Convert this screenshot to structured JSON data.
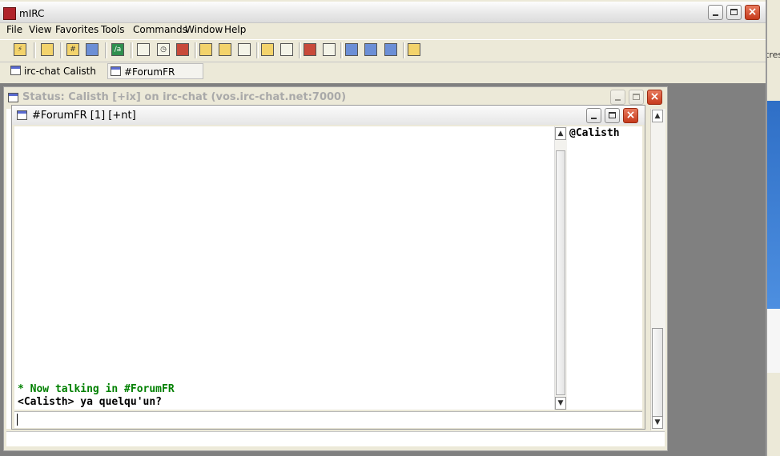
{
  "app": {
    "title": "mIRC",
    "accent_color": "#b0222a",
    "window_controls": {
      "minimize": "minimize-icon",
      "maximize": "maximize-icon",
      "close": "close-icon"
    }
  },
  "menu": [
    "File",
    "View",
    "Favorites",
    "Tools",
    "Commands",
    "Window",
    "Help"
  ],
  "toolbar": {
    "buttons": [
      {
        "icon": "connect-icon"
      },
      {
        "icon": "options-icon"
      },
      {
        "icon": "channel-list-icon"
      },
      {
        "icon": "favorites-icon"
      },
      {
        "icon": "script-editor-icon"
      },
      {
        "icon": "address-book-icon"
      },
      {
        "icon": "timer-icon"
      },
      {
        "icon": "colors-icon"
      },
      {
        "icon": "dcc-send-icon"
      },
      {
        "icon": "dcc-chat-icon"
      },
      {
        "icon": "dcc-options-icon"
      },
      {
        "icon": "received-files-icon"
      },
      {
        "icon": "logs-icon"
      },
      {
        "icon": "notify-list-icon"
      },
      {
        "icon": "url-list-icon"
      },
      {
        "icon": "tile-horizontal-icon"
      },
      {
        "icon": "tile-vertical-icon"
      },
      {
        "icon": "cascade-icon"
      },
      {
        "icon": "away-icon"
      }
    ]
  },
  "switchbar": {
    "items": [
      {
        "label": "irc-chat Calisth"
      },
      {
        "label": "#ForumFR",
        "active": true
      }
    ]
  },
  "status_window": {
    "title": "Status: Calisth [+ix] on irc-chat (vos.irc-chat.net:7000)"
  },
  "channel_window": {
    "title": "#ForumFR [1] [+nt]",
    "messages": [
      {
        "text": "* Now talking in #ForumFR",
        "color": "#008000"
      },
      {
        "text": "<Calisth> ya quelqu'un?",
        "color": "#000000"
      }
    ],
    "nicklist": [
      "@Calisth"
    ],
    "input_value": ""
  },
  "background_window": {
    "fragment_text": "tres"
  }
}
